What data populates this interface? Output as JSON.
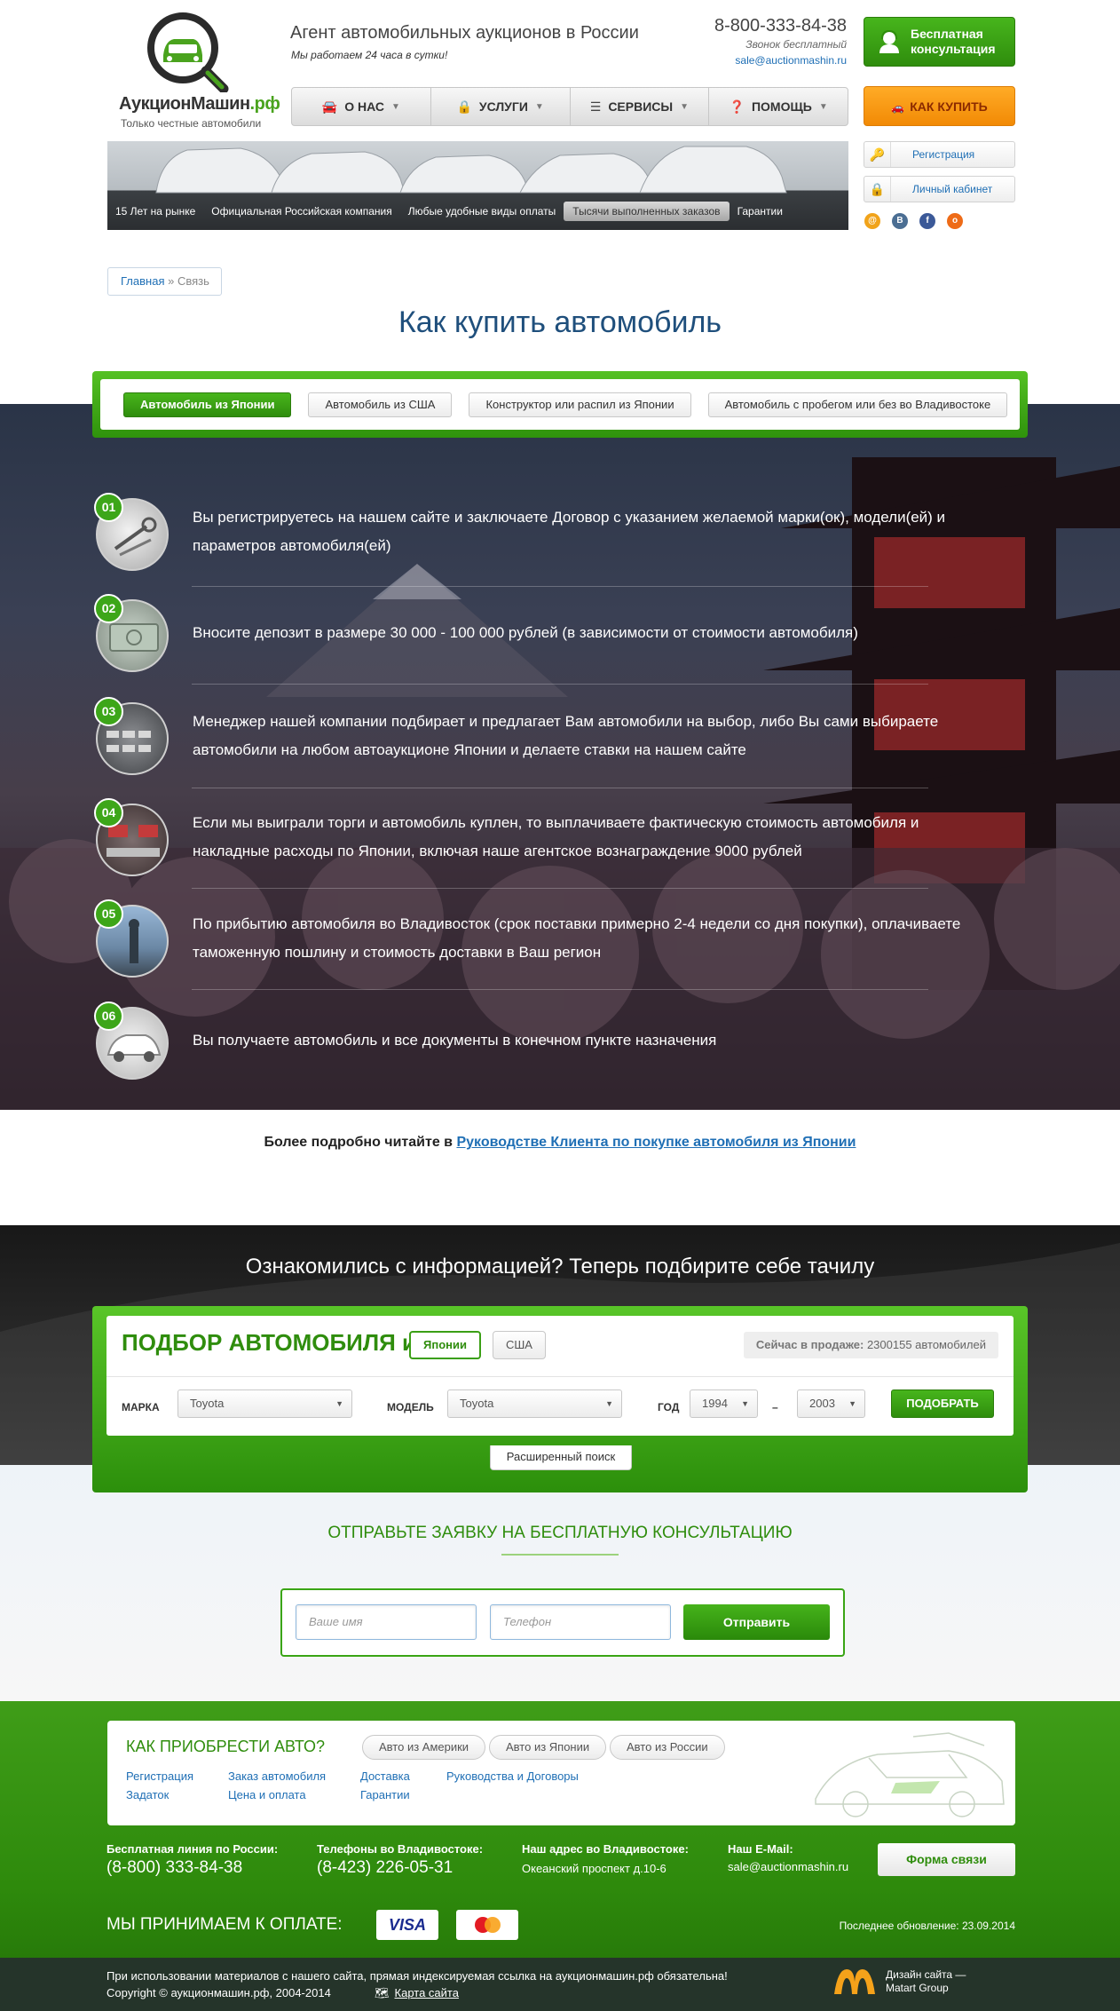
{
  "header": {
    "logo_name": "АукционМашин",
    "logo_tld": ".рф",
    "logo_tagline": "Только честные автомобили",
    "title": "Агент автомобильных аукционов в России",
    "subtitle": "Мы работаем 24 часа в сутки!",
    "phone": "8-800-333-84-38",
    "phone_note": "Звонок бесплатный",
    "email": "sale@auctionmashin.ru",
    "consult_button": "Бесплатная консультация",
    "howbuy_button": "КАК КУПИТЬ",
    "register_button": "Регистрация",
    "cabinet_button": "Личный кабинет"
  },
  "menu": [
    {
      "label": "О НАС",
      "icon": "car-icon"
    },
    {
      "label": "УСЛУГИ",
      "icon": "lock-icon"
    },
    {
      "label": "СЕРВИСЫ",
      "icon": "list-icon"
    },
    {
      "label": "ПОМОЩЬ",
      "icon": "help-icon"
    }
  ],
  "banner": {
    "items": [
      "15 Лет на рынке",
      "Официальная Российская компания",
      "Любые удобные виды оплаты",
      "Тысячи выполненных заказов",
      "Гарантии"
    ],
    "active_index": 3
  },
  "breadcrumb": {
    "home": "Главная",
    "separator": "»",
    "current": "Связь"
  },
  "page_title": "Как купить автомобиль",
  "tabs": [
    "Автомобиль из Японии",
    "Автомобиль из США",
    "Конструктор или распил из Японии",
    "Автомобиль с пробегом или без во Владивостоке"
  ],
  "steps": [
    {
      "num": "01",
      "text": "Вы регистрируетесь на нашем сайте и заключаете Договор с указанием желаемой марки(ок), модели(ей) и параметров автомобиля(ей)"
    },
    {
      "num": "02",
      "text": "Вносите депозит в размере 30 000 - 100 000 рублей (в зависимости от стоимости автомобиля)"
    },
    {
      "num": "03",
      "text": "Менеджер нашей компании подбирает и предлагает Вам автомобили на выбор, либо Вы сами выбираете автомобили на любом автоаукционе Японии и делаете ставки на нашем сайте"
    },
    {
      "num": "04",
      "text": "Если мы выиграли торги и автомобиль куплен, то выплачиваете фактическую стоимость автомобиля и накладные расходы по Японии, включая наше агентское вознаграждение 9000 рублей"
    },
    {
      "num": "05",
      "text": "По прибытию автомобиля во Владивосток (срок поставки примерно 2-4 недели со дня покупки), оплачиваете таможенную пошлину и стоимость доставки в Ваш регион"
    },
    {
      "num": "06",
      "text": "Вы получаете автомобиль и все документы в конечном пункте назначения"
    }
  ],
  "more": {
    "prefix": "Более подробно читайте в ",
    "link": "Руководстве Клиента по покупке автомобиля из Японии"
  },
  "search": {
    "heading": "Ознакомились с информацией? Теперь подбирите себе тачилу",
    "title": "ПОДБОР АВТОМОБИЛЯ из",
    "country_active": "Японии",
    "country_other": "США",
    "onsale_label": "Сейчас в продаже:",
    "onsale_value": "2300155 автомобилей",
    "make_label": "МАРКА",
    "make_value": "Toyota",
    "model_label": "МОДЕЛЬ",
    "model_value": "Toyota",
    "year_label": "ГОД",
    "year_from": "1994",
    "year_dash": "–",
    "year_to": "2003",
    "submit": "ПОДОБРАТЬ",
    "advanced": "Расширенный поиск"
  },
  "consult": {
    "title": "ОТПРАВЬТЕ ЗАЯВКУ НА БЕСПЛАТНУЮ КОНСУЛЬТАЦИЮ",
    "name_placeholder": "Ваше имя",
    "phone_placeholder": "Телефон",
    "submit": "Отправить"
  },
  "footer": {
    "card_title": "КАК ПРИОБРЕСТИ АВТО?",
    "pills": [
      "Авто из Америки",
      "Авто из Японии",
      "Авто из России"
    ],
    "links": [
      "Регистрация",
      "Задаток",
      "Заказ автомобиля",
      "Цена и оплата",
      "Доставка",
      "Гарантии",
      "Руководства и Договоры"
    ],
    "free_line_label": "Бесплатная линия по России:",
    "free_line_value": "(8-800) 333-84-38",
    "vl_phone_label": "Телефоны во Владивостоке:",
    "vl_phone_value": "(8-423) 226-05-31",
    "address_label": "Наш адрес во Владивостоке:",
    "address_value": "Океанский проспект д.10-6",
    "email_label": "Наш E-Mail:",
    "email_value": "sale@auctionmashin.ru",
    "contact_form_button": "Форма связи",
    "payment_label": "МЫ ПРИНИМАЕМ К ОПЛАТЕ:",
    "visa": "VISA",
    "updated": "Последнее обновление: 23.09.2014",
    "notice": "При использовании материалов с нашего сайта, прямая индексируемая ссылка на аукционмашин.рф обязательна!",
    "copyright": "Copyright © аукционмашин.рф, 2004-2014",
    "sitemap": "Карта сайта",
    "design_line1": "Дизайн сайта —",
    "design_line2": "Matart Group"
  },
  "colors": {
    "brand_green": "#3da619",
    "link_blue": "#1f6fb5",
    "orange": "#f28a05",
    "title_blue": "#1f4f7c"
  }
}
